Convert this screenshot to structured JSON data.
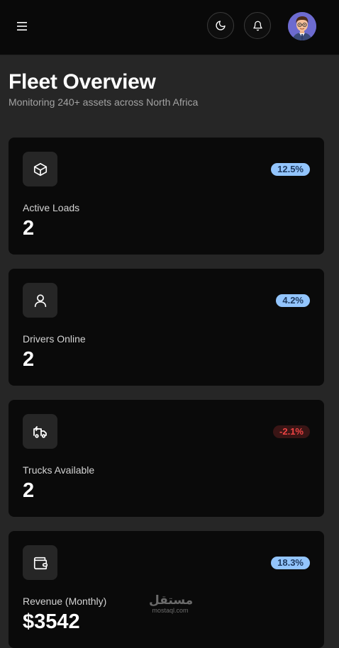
{
  "header": {
    "menu_icon": "hamburger-menu-icon",
    "theme_icon": "moon-icon",
    "notifications_icon": "bell-icon",
    "avatar": "user-avatar"
  },
  "page": {
    "title": "Fleet Overview",
    "subtitle": "Monitoring 240+ assets across North Africa"
  },
  "stats": [
    {
      "icon": "box-icon",
      "label": "Active Loads",
      "value": "2",
      "change": "12.5%",
      "trend": "up"
    },
    {
      "icon": "user-icon",
      "label": "Drivers Online",
      "value": "2",
      "change": "4.2%",
      "trend": "up"
    },
    {
      "icon": "truck-icon",
      "label": "Trucks Available",
      "value": "2",
      "change": "-2.1%",
      "trend": "down"
    },
    {
      "icon": "wallet-icon",
      "label": "Revenue (Monthly)",
      "value": "$3542",
      "change": "18.3%",
      "trend": "up"
    }
  ],
  "watermark": {
    "main": "مستقل",
    "sub": "mostaql.com"
  },
  "colors": {
    "background": "#262626",
    "topbar": "#090909",
    "card": "#0a0a0a",
    "badge_up_bg": "#93c5fd",
    "badge_down_text": "#ef4444"
  }
}
